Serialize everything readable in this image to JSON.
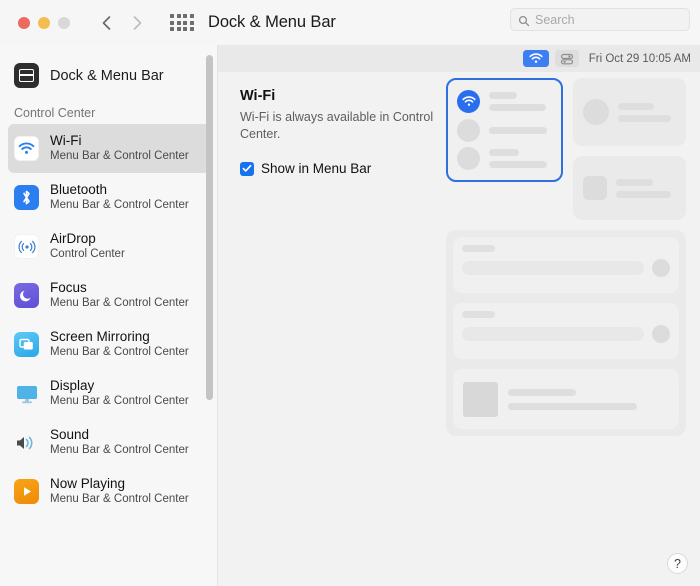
{
  "window": {
    "title": "Dock & Menu Bar",
    "traffic_lights": [
      "close",
      "minimize",
      "zoom"
    ],
    "back_label": "Back",
    "forward_label": "Forward",
    "grid_label": "Show All"
  },
  "search": {
    "placeholder": "Search",
    "value": ""
  },
  "sidebar": {
    "header": {
      "label": "Dock & Menu Bar",
      "icon": "dock-icon"
    },
    "section_label": "Control Center",
    "items": [
      {
        "label": "Wi-Fi",
        "sub": "Menu Bar & Control Center",
        "icon": "wifi-icon",
        "selected": true
      },
      {
        "label": "Bluetooth",
        "sub": "Menu Bar & Control Center",
        "icon": "bluetooth-icon",
        "selected": false
      },
      {
        "label": "AirDrop",
        "sub": "Control Center",
        "icon": "airdrop-icon",
        "selected": false
      },
      {
        "label": "Focus",
        "sub": "Menu Bar & Control Center",
        "icon": "focus-moon-icon",
        "selected": false
      },
      {
        "label": "Screen Mirroring",
        "sub": "Menu Bar & Control Center",
        "icon": "screen-mirroring-icon",
        "selected": false
      },
      {
        "label": "Display",
        "sub": "Menu Bar & Control Center",
        "icon": "display-icon",
        "selected": false
      },
      {
        "label": "Sound",
        "sub": "Menu Bar & Control Center",
        "icon": "sound-icon",
        "selected": false
      },
      {
        "label": "Now Playing",
        "sub": "Menu Bar & Control Center",
        "icon": "now-playing-icon",
        "selected": false
      }
    ]
  },
  "main": {
    "menu_bar_preview": {
      "wifi_icon": "wifi-icon",
      "control_center_icon": "control-center-icon",
      "datetime": "Fri Oct 29  10:05 AM"
    },
    "heading": "Wi-Fi",
    "description": "Wi-Fi is always available in Control Center.",
    "checkbox": {
      "label": "Show in Menu Bar",
      "checked": true
    }
  },
  "help": {
    "label": "?"
  },
  "colors": {
    "accent": "#2a7ef0",
    "selection_border": "#2f6fe0",
    "sidebar_selected": "#dcdcdc",
    "sidebar_bg": "#f7f7f7",
    "main_bg": "#f2f2f2",
    "menubar_bg": "#e9e9e9",
    "checkbox": "#1673f0"
  }
}
